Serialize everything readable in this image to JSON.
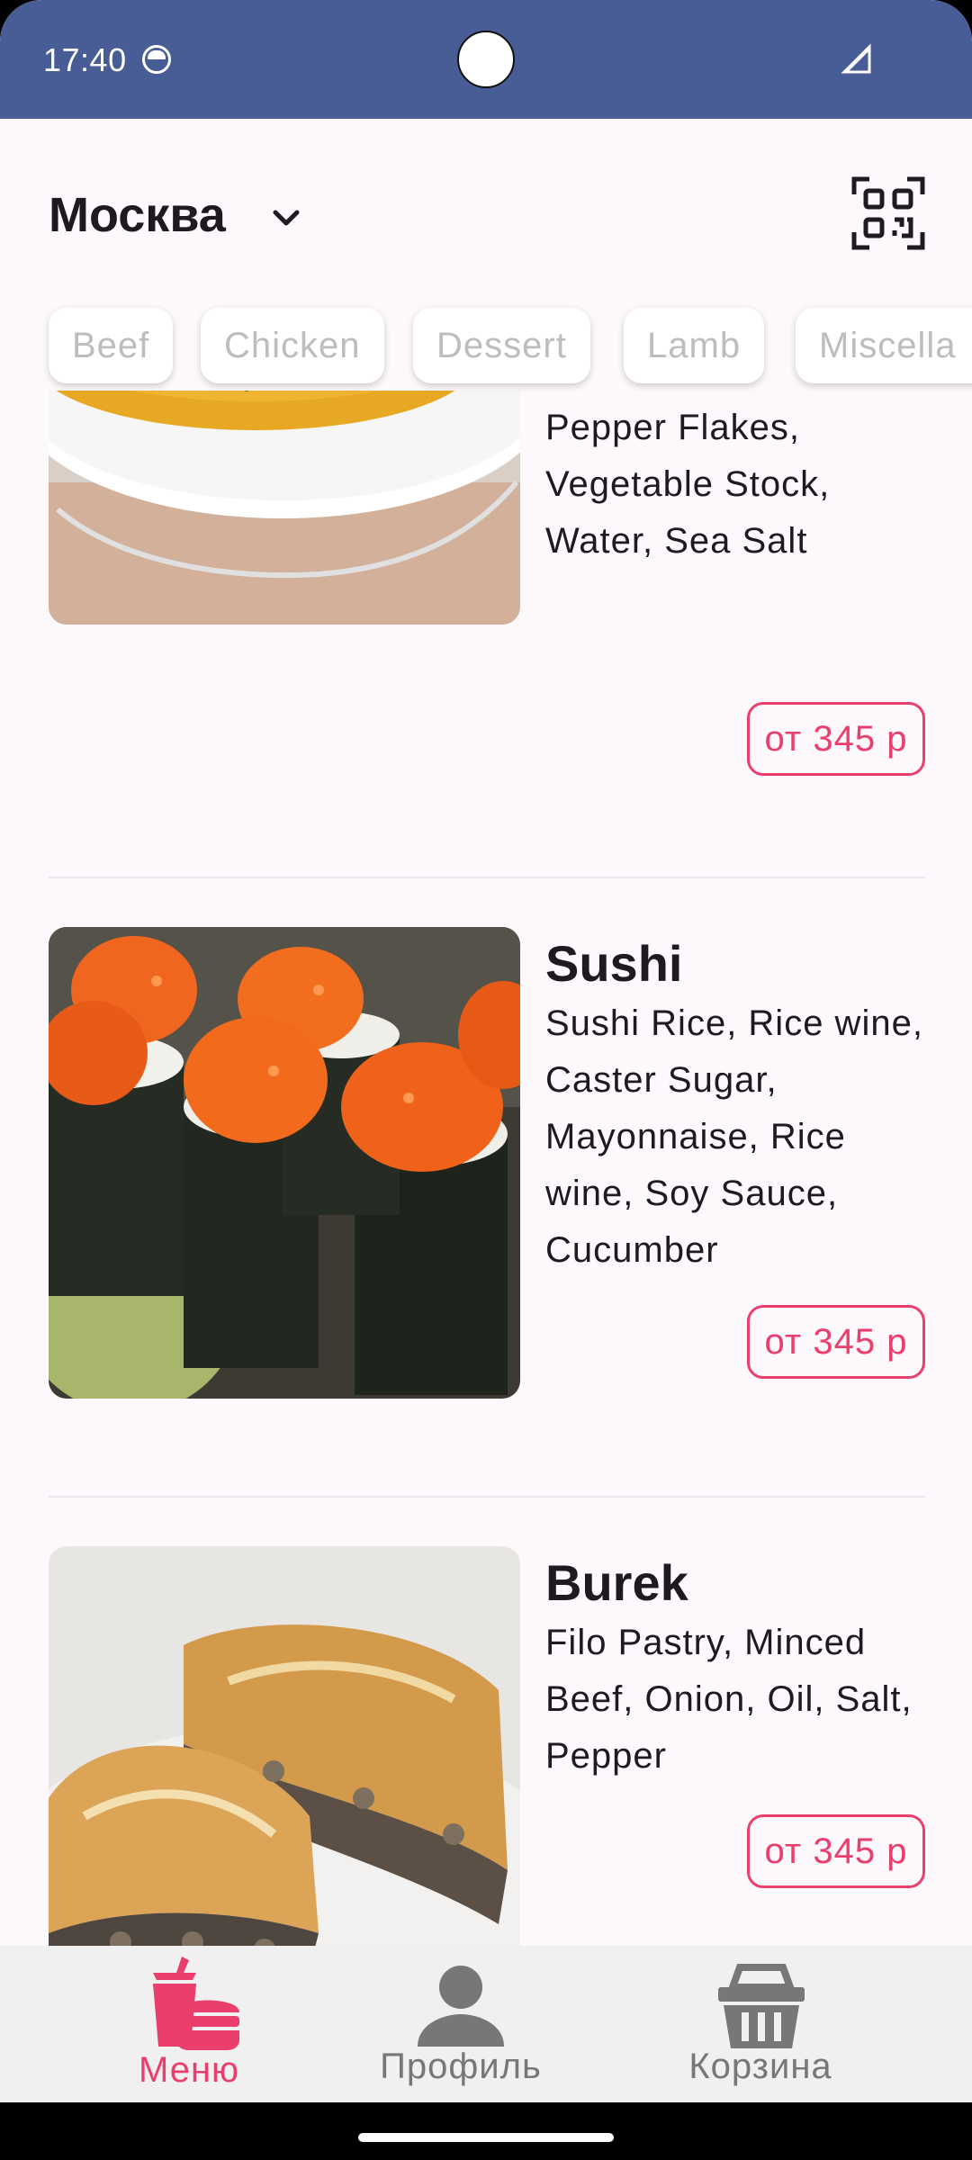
{
  "status_bar": {
    "time": "17:40"
  },
  "header": {
    "city": "Москва"
  },
  "categories": [
    "Beef",
    "Chicken",
    "Dessert",
    "Lamb",
    "Miscella"
  ],
  "dishes": [
    {
      "title": "",
      "description": "Paprika, Mint, Thyme, Black Pepper, Red Pepper Flakes, Vegetable Stock, Water, Sea Salt",
      "price": "от 345 р"
    },
    {
      "title": "Sushi",
      "description": "Sushi Rice, Rice wine, Caster Sugar, Mayonnaise, Rice wine, Soy Sauce, Cucumber",
      "price": "от 345 р"
    },
    {
      "title": "Burek",
      "description": "Filo Pastry, Minced Beef, Onion, Oil, Salt, Pepper",
      "price": "от 345 р"
    }
  ],
  "bottom_nav": {
    "items": [
      {
        "label": "Меню",
        "icon": "food-icon",
        "active": true
      },
      {
        "label": "Профиль",
        "icon": "person-icon",
        "active": false
      },
      {
        "label": "Корзина",
        "icon": "basket-icon",
        "active": false
      }
    ]
  },
  "colors": {
    "status_bar": "#485C95",
    "accent": "#EA3E6C",
    "background": "#FCF8FC",
    "nav_inactive": "#777777"
  }
}
